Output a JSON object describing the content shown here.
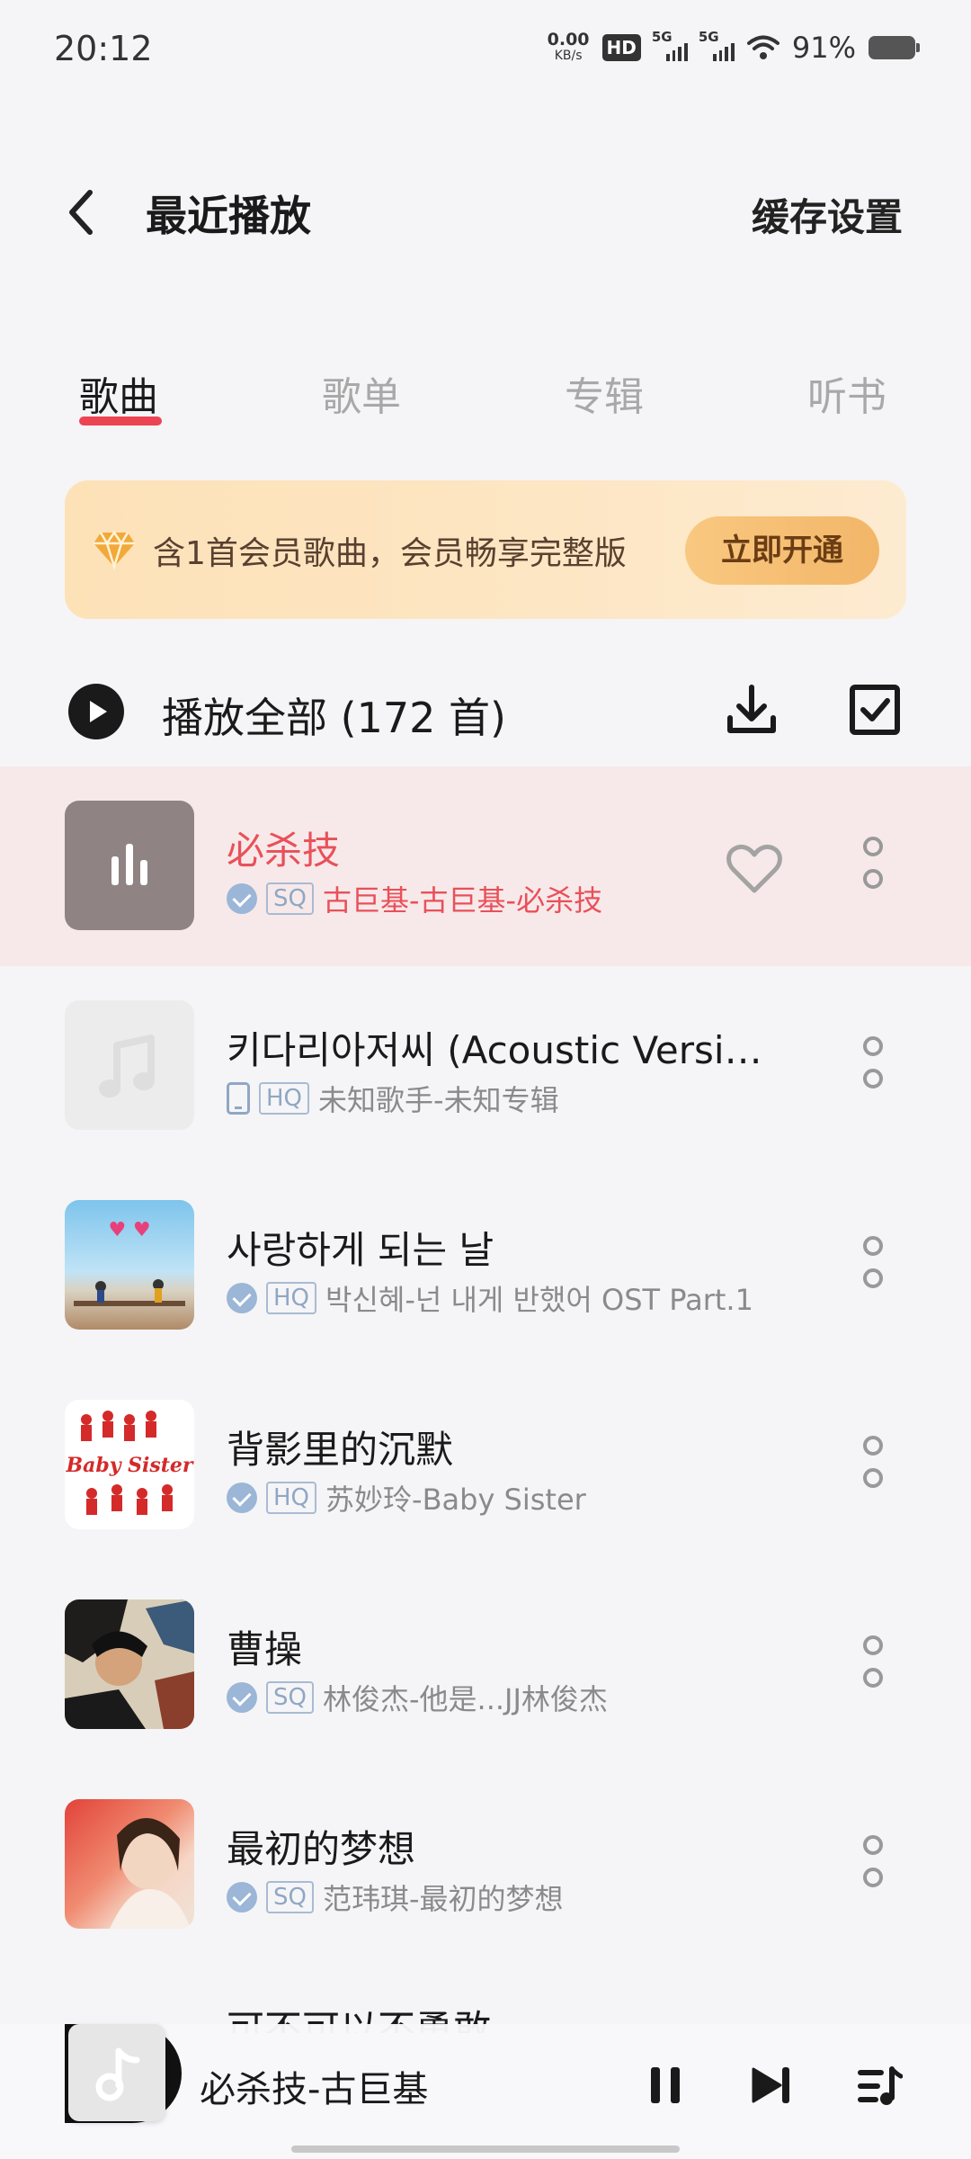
{
  "status_bar": {
    "time": "20:12",
    "net_speed_value": "0.00",
    "net_speed_unit": "KB/s",
    "hd_label": "HD",
    "sim1_label": "5G",
    "sim2_label": "5G",
    "battery_percent": "91%"
  },
  "header": {
    "title": "最近播放",
    "action": "缓存设置"
  },
  "tabs": [
    {
      "label": "歌曲",
      "active": true
    },
    {
      "label": "歌单",
      "active": false
    },
    {
      "label": "专辑",
      "active": false
    },
    {
      "label": "听书",
      "active": false
    }
  ],
  "vip_banner": {
    "text": "含1首会员歌曲，会员畅享完整版",
    "button": "立即开通"
  },
  "play_all": {
    "label": "播放全部 (172 首)"
  },
  "songs": [
    {
      "title": "必杀技",
      "quality": "SQ",
      "subtitle": "古巨基-古巨基-必杀技",
      "playing": true,
      "source_icon": "check-icon"
    },
    {
      "title": "키다리아저씨 (Acoustic Versio…",
      "quality": "HQ",
      "subtitle": "未知歌手-未知专辑",
      "playing": false,
      "source_icon": "phone-icon"
    },
    {
      "title": "사랑하게 되는 날",
      "quality": "HQ",
      "subtitle": "박신혜-넌 내게 반했어 OST Part.1",
      "playing": false,
      "source_icon": "check-icon"
    },
    {
      "title": "背影里的沉默",
      "quality": "HQ",
      "subtitle": "苏妙玲-Baby Sister",
      "playing": false,
      "source_icon": "check-icon"
    },
    {
      "title": "曹操",
      "quality": "SQ",
      "subtitle": "林俊杰-他是...JJ林俊杰",
      "playing": false,
      "source_icon": "check-icon"
    },
    {
      "title": "最初的梦想",
      "quality": "SQ",
      "subtitle": "范玮琪-最初的梦想",
      "playing": false,
      "source_icon": "check-icon"
    }
  ],
  "peek_song": {
    "title": "可不可以不勇敢"
  },
  "mini_player": {
    "title": "必杀技-古巨基"
  },
  "colors": {
    "accent": "#ec4452",
    "playing_row_bg": "#f7e9e9",
    "vip_gold": "#f2b668"
  }
}
